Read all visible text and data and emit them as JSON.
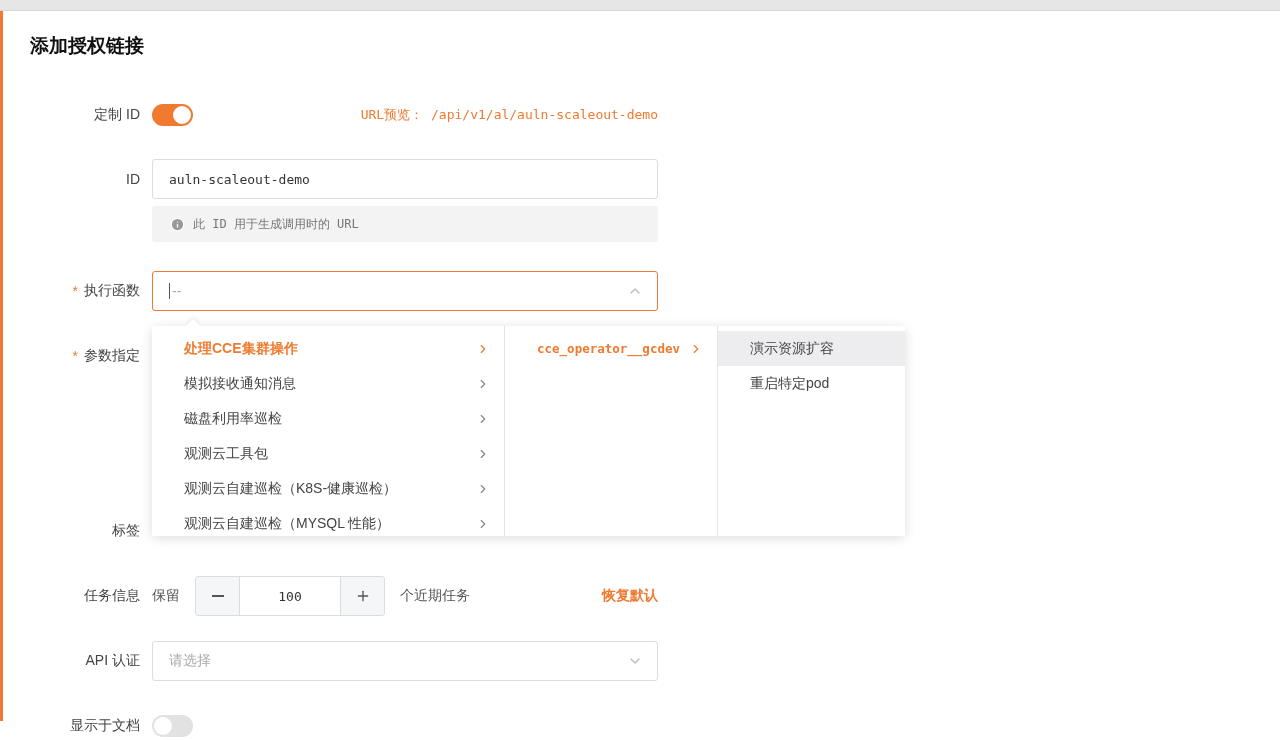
{
  "title": "添加授权链接",
  "fields": [
    {
      "kind": "toggle",
      "label": "定制 ID",
      "on": true,
      "preview": "URL预览： /api/v1/al/auln-scaleout-demo"
    },
    {
      "kind": "text",
      "label": "ID",
      "value": "auln-scaleout-demo",
      "hint": "此 ID 用于生成调用时的 URL"
    },
    {
      "kind": "cascader",
      "label": "执行函数",
      "required_mark": "*",
      "placeholder": "--",
      "expanded": true
    },
    {
      "kind": "params",
      "label": "参数指定",
      "required_mark": "*"
    },
    {
      "kind": "tags",
      "label": "标签"
    },
    {
      "kind": "stepper",
      "label": "任务信息",
      "prefix": "保留",
      "value": "100",
      "suffix": "个近期任务",
      "action": "恢复默认"
    },
    {
      "kind": "select",
      "label": "API 认证",
      "placeholder": "请选择",
      "expanded": false
    },
    {
      "kind": "toggle",
      "label": "显示于文档",
      "on": false
    }
  ],
  "cascader_menu": {
    "columns": [
      {
        "items": [
          {
            "label": "处理CCE集群操作",
            "selected": true,
            "highlighted": false,
            "has_children": true
          },
          {
            "label": "模拟接收通知消息",
            "selected": false,
            "highlighted": false,
            "has_children": true
          },
          {
            "label": "磁盘利用率巡检",
            "selected": false,
            "highlighted": false,
            "has_children": true
          },
          {
            "label": "观测云工具包",
            "selected": false,
            "highlighted": false,
            "has_children": true
          },
          {
            "label": "观测云自建巡检（K8S-健康巡检）",
            "selected": false,
            "highlighted": false,
            "has_children": true
          },
          {
            "label": "观测云自建巡检（MYSQL 性能）",
            "selected": false,
            "highlighted": false,
            "has_children": true
          }
        ]
      },
      {
        "items": [
          {
            "label": "cce_operator__gcdev",
            "selected": true,
            "highlighted": false,
            "has_children": true
          }
        ]
      },
      {
        "items": [
          {
            "label": "演示资源扩容",
            "selected": false,
            "highlighted": true,
            "has_children": false
          },
          {
            "label": "重启特定pod",
            "selected": false,
            "highlighted": false,
            "has_children": false
          }
        ]
      }
    ]
  }
}
